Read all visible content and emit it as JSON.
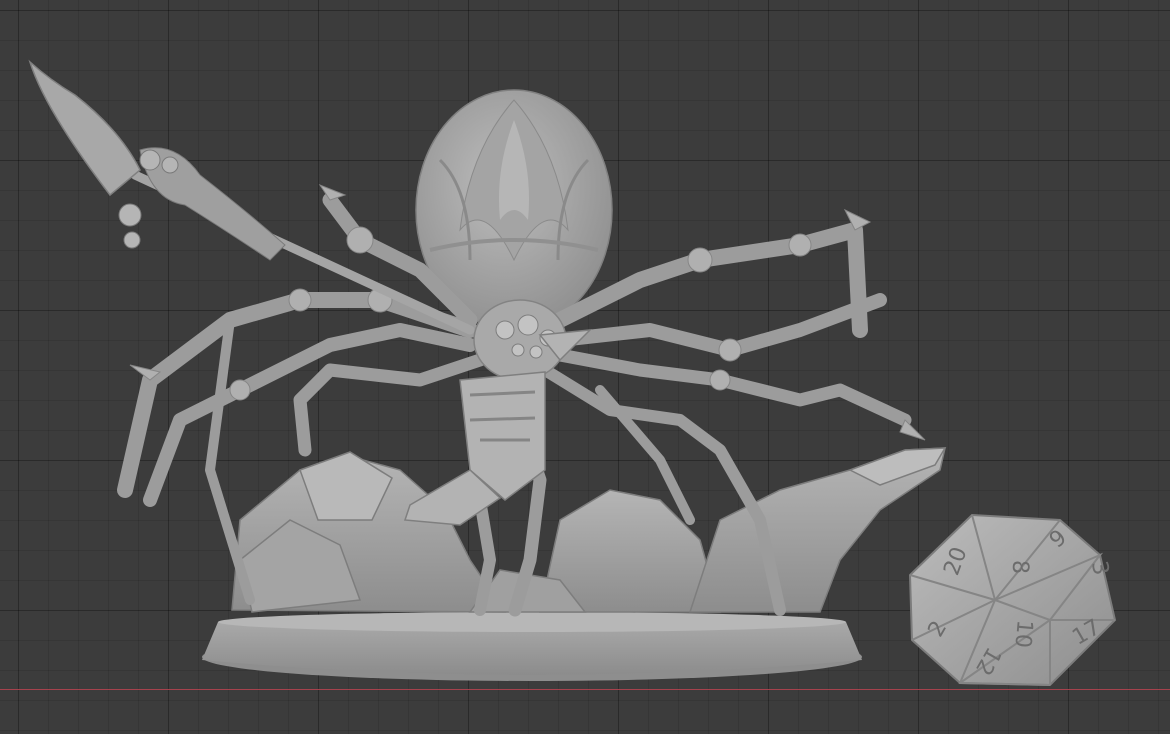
{
  "viewport": {
    "background_color": "#3c3c3c",
    "grid_color": "#2e2e2e",
    "x_axis_color": "#b1434f",
    "model_color": "#9a9a9a"
  },
  "d20": {
    "face_numbers": [
      "20",
      "8",
      "10",
      "2",
      "12",
      "17",
      "3",
      "6"
    ]
  }
}
